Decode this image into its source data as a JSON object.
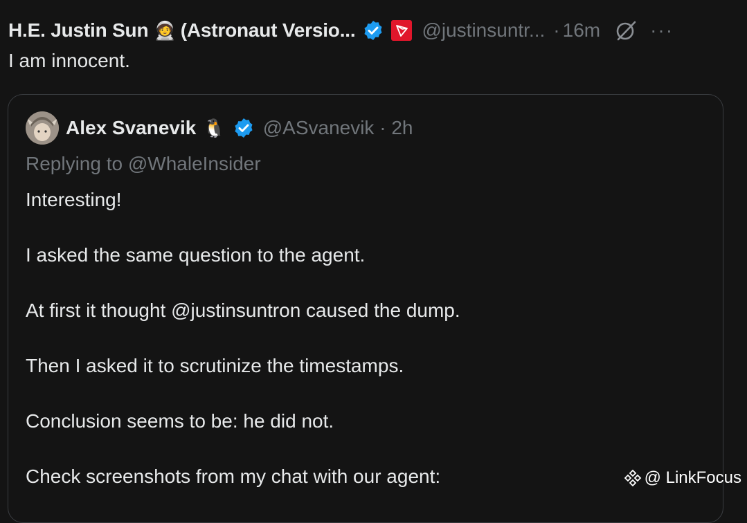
{
  "tweet": {
    "display_name": "H.E. Justin Sun",
    "name_emoji": "🧑‍🚀",
    "name_suffix": "(Astronaut Versio...",
    "handle": "@justinsuntr...",
    "separator": "·",
    "time": "16m",
    "more": "···",
    "text": "I am innocent.",
    "verified_color": "#1d9bf0",
    "tron_color": "#e0162b"
  },
  "quoted": {
    "display_name": "Alex Svanevik",
    "name_emoji": "🐧",
    "handle": "@ASvanevik · 2h",
    "replying_to": "Replying to @WhaleInsider",
    "paragraphs": [
      "Interesting!",
      "I asked the same question to the agent.",
      "At first it thought @justinsuntron caused the dump.",
      "Then I asked it to scrutinize the timestamps.",
      "Conclusion seems to be: he did not.",
      "Check screenshots from my chat with our agent:"
    ]
  },
  "watermark": {
    "text": "@ LinkFocus"
  }
}
